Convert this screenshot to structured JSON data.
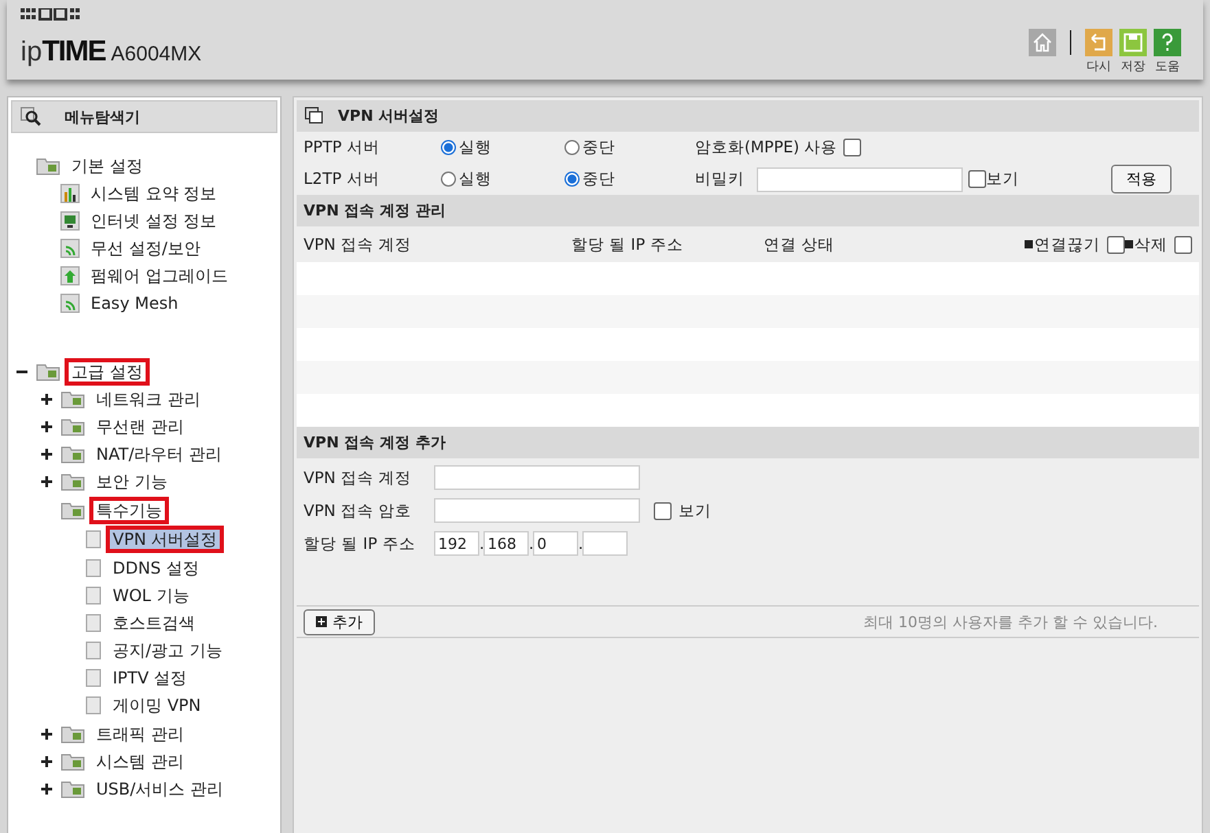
{
  "header": {
    "logo": [
      "ip",
      "TIME"
    ],
    "model": "A6004MX",
    "toolbar": [
      {
        "kind": "home"
      },
      {
        "kind": "reset",
        "label": "다시"
      },
      {
        "kind": "save",
        "label": "저장"
      },
      {
        "kind": "help",
        "label": "도움"
      }
    ]
  },
  "sidebar": {
    "title": "메뉴탐색기",
    "tree": [
      {
        "label": "기본 설정",
        "kind": "folder",
        "highlighted": false,
        "children": [
          {
            "label": "시스템 요약 정보",
            "kind": "chart",
            "selected": false,
            "highlighted": false
          },
          {
            "label": "인터넷 설정 정보",
            "kind": "monitor",
            "selected": false,
            "highlighted": false
          },
          {
            "label": "무선 설정/보안",
            "kind": "wifi",
            "selected": false,
            "highlighted": false
          },
          {
            "label": "펌웨어 업그레이드",
            "kind": "upload",
            "selected": false,
            "highlighted": false
          },
          {
            "label": "Easy Mesh",
            "kind": "wifi",
            "selected": false,
            "highlighted": false
          }
        ]
      },
      {
        "label": "고급 설정",
        "kind": "folder",
        "expanded": true,
        "highlighted": true,
        "children": [
          {
            "label": "네트워크 관리",
            "kind": "folder",
            "expanded": false,
            "highlighted": false
          },
          {
            "label": "무선랜 관리",
            "kind": "folder",
            "expanded": false,
            "highlighted": false
          },
          {
            "label": "NAT/라우터 관리",
            "kind": "folder",
            "expanded": false,
            "highlighted": false
          },
          {
            "label": "보안 기능",
            "kind": "folder",
            "expanded": false,
            "highlighted": false
          },
          {
            "label": "특수기능",
            "kind": "folder",
            "highlighted": true,
            "children": [
              {
                "label": "VPN 서버설정",
                "kind": "page",
                "selected": true,
                "highlighted": true
              },
              {
                "label": "DDNS 설정",
                "kind": "page",
                "selected": false,
                "highlighted": false
              },
              {
                "label": "WOL 기능",
                "kind": "page",
                "selected": false,
                "highlighted": false
              },
              {
                "label": "호스트검색",
                "kind": "page",
                "selected": false,
                "highlighted": false
              },
              {
                "label": "공지/광고 기능",
                "kind": "page",
                "selected": false,
                "highlighted": false
              },
              {
                "label": "IPTV 설정",
                "kind": "page",
                "selected": false,
                "highlighted": false
              },
              {
                "label": "게이밍 VPN",
                "kind": "page",
                "selected": false,
                "highlighted": false
              }
            ]
          },
          {
            "label": "트래픽 관리",
            "kind": "folder",
            "expanded": false,
            "highlighted": false
          },
          {
            "label": "시스템 관리",
            "kind": "folder",
            "expanded": false,
            "highlighted": false
          },
          {
            "label": "USB/서비스 관리",
            "kind": "folder",
            "expanded": false,
            "highlighted": false
          }
        ]
      }
    ]
  },
  "main": {
    "title": "VPN 서버설정",
    "servers": [
      {
        "label": "PPTP 서버",
        "options": [
          {
            "label": "실행",
            "selected": true
          },
          {
            "label": "중단",
            "selected": false
          }
        ]
      },
      {
        "label": "L2TP 서버",
        "options": [
          {
            "label": "실행",
            "selected": false
          },
          {
            "label": "중단",
            "selected": true
          }
        ]
      }
    ],
    "mppe": {
      "label": "암호화(MPPE) 사용",
      "checked": false
    },
    "secret": {
      "label": "비밀키",
      "show_label": "보기",
      "show_checked": false
    },
    "apply": "적용",
    "accounts": {
      "title": "VPN 접속 계정 관리",
      "columns": [
        {
          "kind": "text",
          "label": "VPN 접속 계정"
        },
        {
          "kind": "text",
          "label": "할당 될 IP 주소"
        },
        {
          "kind": "text",
          "label": "연결 상태"
        },
        {
          "kind": "check",
          "label": "연결끊기",
          "checked": false
        },
        {
          "kind": "check",
          "label": "삭제",
          "checked": false
        }
      ]
    },
    "add": {
      "title": "VPN 접속 계정 추가",
      "account_label": "VPN 접속 계정",
      "password_label": "VPN 접속 암호",
      "show_label": "보기",
      "show_checked": false,
      "ip_label": "할당 될 IP 주소",
      "ip_parts": [
        "192",
        "168",
        "0"
      ],
      "ip_separator": "."
    },
    "footer": {
      "add_button": "추가",
      "note": "최대 10명의 사용자를 추가 할 수 있습니다."
    }
  }
}
